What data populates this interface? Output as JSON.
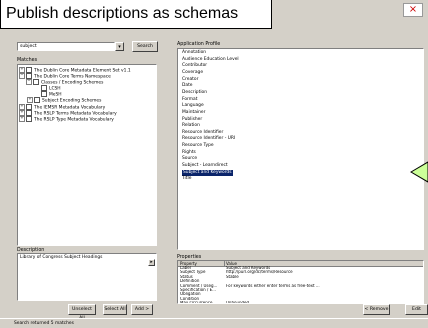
{
  "callout_title": "Publish descriptions as schemas",
  "window_controls": {
    "close": "×"
  },
  "search": {
    "value": "subject",
    "button_label": "Search"
  },
  "matches": {
    "label": "Matches",
    "tree": [
      {
        "text": "The Dublin Core Metadata Element Set v1.1",
        "expander": "+",
        "checkbox": true
      },
      {
        "text": "The Dublin Core Terms Namespace",
        "expander": "−",
        "checkbox": true
      },
      {
        "text": "Classes / Encoding Schemes",
        "expander": "−",
        "checkbox": true
      },
      {
        "text": "LCSH",
        "expander": "",
        "checkbox": true
      },
      {
        "text": "MeSH",
        "expander": "",
        "checkbox": true
      },
      {
        "text": "Subject Encoding Schemes",
        "expander": "+",
        "checkbox": true
      },
      {
        "text": "The IEMSR Metadata Vocabulary",
        "expander": "+",
        "checkbox": true
      },
      {
        "text": "The RSLP Terms Metadata Vocabulary",
        "expander": "+",
        "checkbox": true
      },
      {
        "text": "The RSLP Type Metadata Vocabulary",
        "expander": "+",
        "checkbox": true
      }
    ]
  },
  "description": {
    "label": "Description",
    "text": "Library of Congress Subject Headings"
  },
  "left_buttons": {
    "unselect_all": "Unselect All",
    "select_all": "Select All",
    "add": "Add >"
  },
  "status_bar": "Search returned 5 matches",
  "application_profile": {
    "label": "Application Profile",
    "items": [
      "Annotation",
      "Audience Education Level",
      "Contributor",
      "Coverage",
      "Creator",
      "Date",
      "Description",
      "Format",
      "Language",
      "Maintainer",
      "Publisher",
      "Relation",
      "Resource Identifier",
      "Resource Identifier - URI",
      "Resource Type",
      "Rights",
      "Source",
      "Subject - Learndirect",
      "Subject and Keywords",
      "Title"
    ],
    "selected_index": 18
  },
  "properties": {
    "label": "Properties",
    "columns": [
      "Property",
      "Value"
    ],
    "rows": [
      [
        "Label",
        "Subject and Keywords"
      ],
      [
        "Subject Type",
        "http://purl.org/dc/terms/Resource"
      ],
      [
        "Status",
        "Stable"
      ],
      [
        "Definition",
        ""
      ],
      [
        "Comment / Useg...",
        "For keywords either enter terms as free-text ..."
      ],
      [
        "Specification / E...",
        ""
      ],
      [
        "Obligation",
        ""
      ],
      [
        "Condition",
        ""
      ],
      [
        "Max Occurrence",
        "Unbounded"
      ]
    ]
  },
  "right_buttons": {
    "remove": "< Remove",
    "edit": "Edit"
  }
}
